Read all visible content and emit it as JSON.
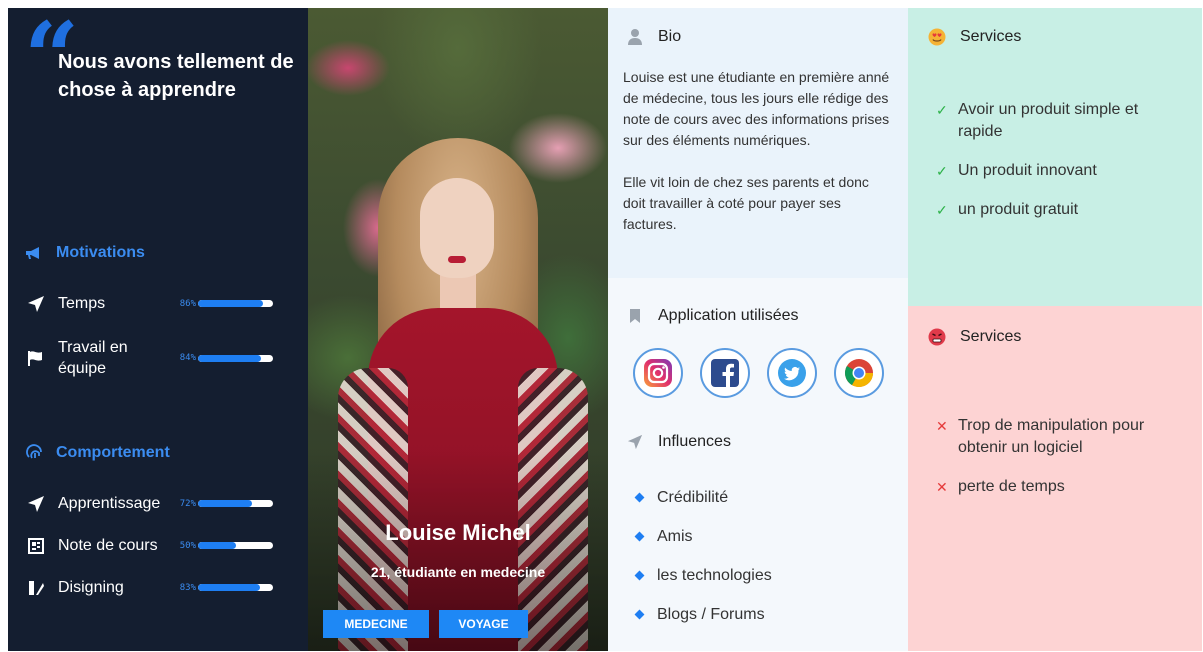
{
  "profile": {
    "headline": "Nous avons tellement de chose à apprendre",
    "name": "Louise Michel",
    "subtitle": "21, étudiante en medecine",
    "tags": [
      "MEDECINE",
      "VOYAGE"
    ]
  },
  "motivations": {
    "title": "Motivations",
    "items": [
      {
        "label": "Temps",
        "pct": "86%",
        "value": 0.86,
        "icon": "paper-plane-icon"
      },
      {
        "label": "Travail en équipe",
        "pct": "84%",
        "value": 0.84,
        "icon": "flag-icon"
      }
    ]
  },
  "behavior": {
    "title": "Comportement",
    "items": [
      {
        "label": "Apprentissage",
        "pct": "72%",
        "value": 0.72,
        "icon": "paper-plane-icon"
      },
      {
        "label": "Note de cours",
        "pct": "50%",
        "value": 0.5,
        "icon": "notes-icon"
      },
      {
        "label": "Disigning",
        "pct": "83%",
        "value": 0.83,
        "icon": "design-icon"
      }
    ]
  },
  "bio": {
    "title": "Bio",
    "paragraphs": [
      "Louise est une étudiante en première anné de médecine, tous les jours elle rédige des note de cours avec des informations prises sur des éléments numériques.",
      "Elle vit loin de chez ses parents et donc doit travailler à coté pour payer ses factures."
    ]
  },
  "apps": {
    "title": "Application utilisées",
    "icons": [
      "instagram-icon",
      "facebook-icon",
      "twitter-icon",
      "chrome-icon"
    ]
  },
  "influences": {
    "title": "Influences",
    "items": [
      "Crédibilité",
      "Amis",
      "les technologies",
      "Blogs / Forums"
    ]
  },
  "services_positive": {
    "title": "Services",
    "items": [
      "Avoir un produit simple et rapide",
      "Un produit innovant",
      "un produit gratuit"
    ]
  },
  "services_negative": {
    "title": "Services",
    "items": [
      "Trop de manipulation pour obtenir un logiciel",
      "perte de temps"
    ]
  },
  "colors": {
    "dark": "#141e30",
    "accent": "#1e7ef2",
    "bio_bg": "#eaf3fb",
    "good_bg": "#c8efe5",
    "bad_bg": "#fdd3d3"
  }
}
